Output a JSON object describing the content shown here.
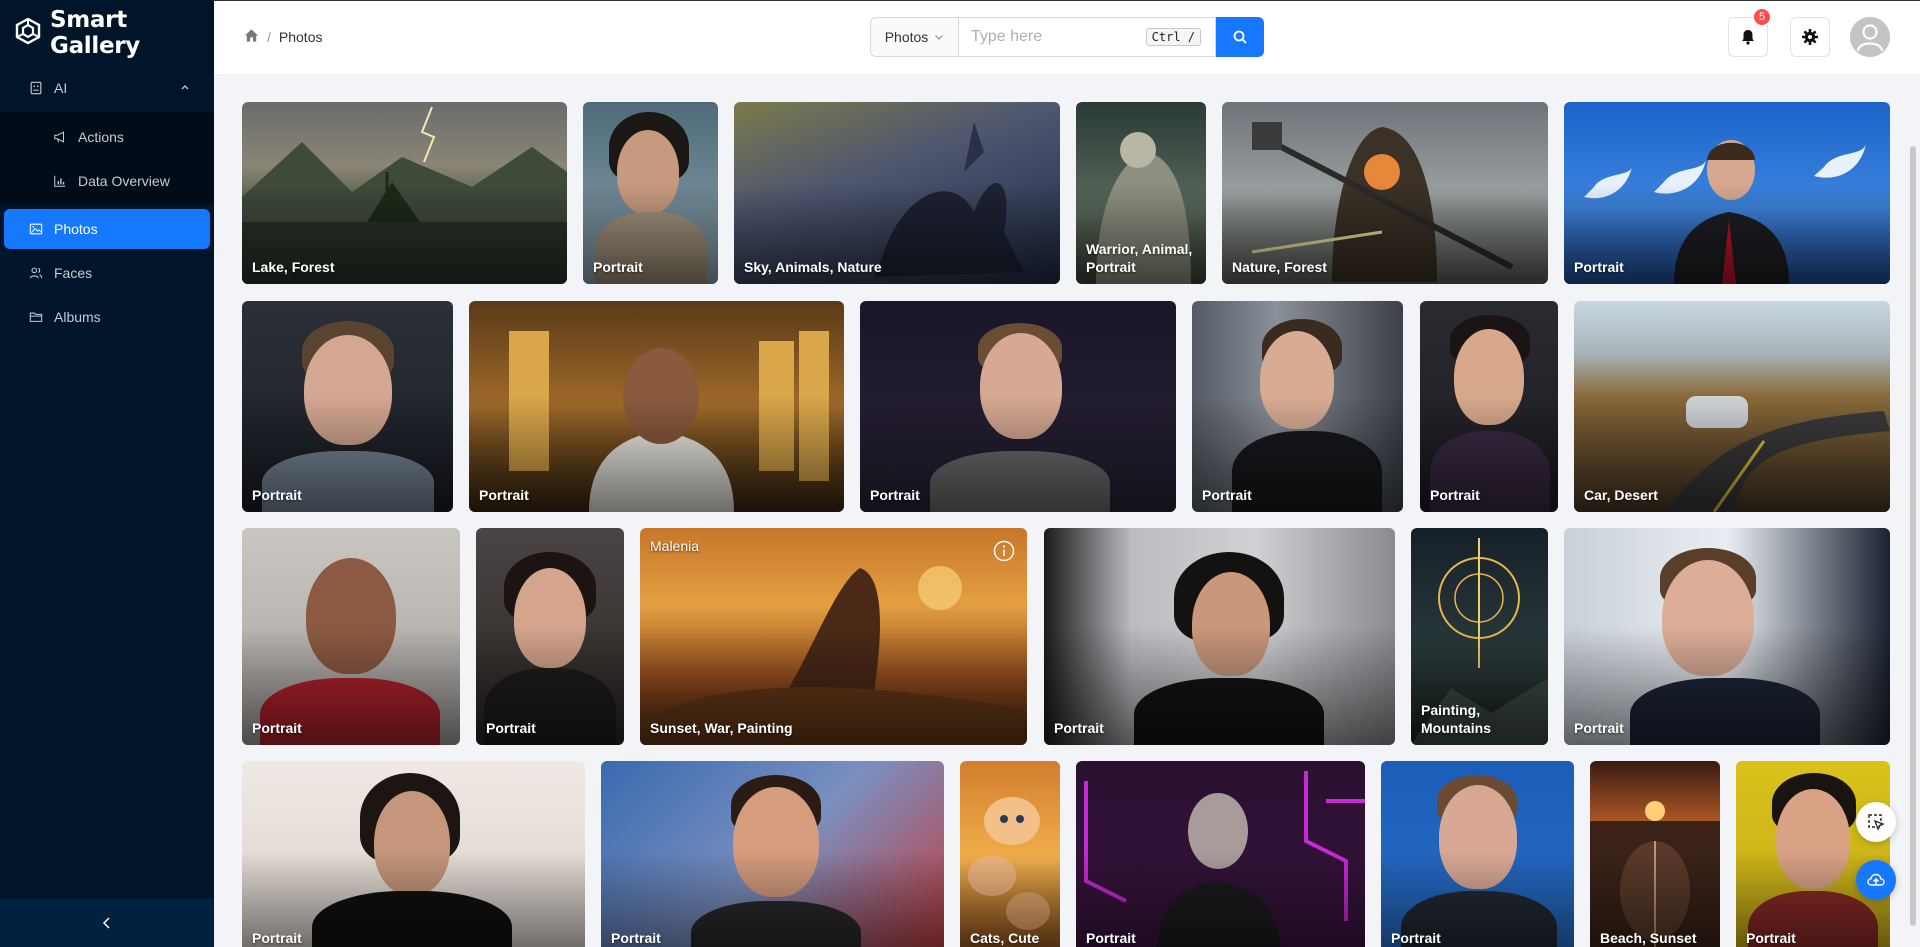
{
  "app": {
    "title": "Smart Gallery"
  },
  "sidebar": {
    "items": [
      {
        "label": "AI",
        "icon": "robot-icon"
      },
      {
        "label": "Actions",
        "icon": "megaphone-icon"
      },
      {
        "label": "Data Overview",
        "icon": "bar-chart-icon"
      },
      {
        "label": "Photos",
        "icon": "picture-icon",
        "active": true
      },
      {
        "label": "Faces",
        "icon": "users-icon"
      },
      {
        "label": "Albums",
        "icon": "folder-icon"
      }
    ]
  },
  "header": {
    "breadcrumb": [
      "Photos"
    ],
    "search": {
      "type": "Photos",
      "placeholder": "Type here",
      "value": "",
      "shortcut": "Ctrl /"
    },
    "notifications_count": "5"
  },
  "colors": {
    "accent": "#1677ff",
    "sidebar": "#001529",
    "badge": "#ff4d4f"
  },
  "photos": [
    {
      "caption": "Lake, Forest"
    },
    {
      "caption": "Portrait"
    },
    {
      "caption": "Sky, Animals, Nature"
    },
    {
      "caption": "Warrior, Animal, Portrait"
    },
    {
      "caption": "Nature, Forest"
    },
    {
      "caption": "Portrait"
    },
    {
      "caption": "Portrait"
    },
    {
      "caption": "Portrait"
    },
    {
      "caption": "Portrait"
    },
    {
      "caption": "Portrait"
    },
    {
      "caption": "Portrait"
    },
    {
      "caption": "Car, Desert"
    },
    {
      "caption": "Portrait"
    },
    {
      "caption": "Portrait"
    },
    {
      "caption": "Sunset, War, Painting",
      "title": "Malenia"
    },
    {
      "caption": "Portrait"
    },
    {
      "caption": "Painting, Mountains"
    },
    {
      "caption": "Portrait"
    },
    {
      "caption": "Portrait"
    },
    {
      "caption": "Portrait"
    },
    {
      "caption": "Cats, Cute"
    },
    {
      "caption": "Portrait"
    },
    {
      "caption": "Portrait"
    },
    {
      "caption": "Beach, Sunset"
    },
    {
      "caption": "Portrait"
    }
  ]
}
